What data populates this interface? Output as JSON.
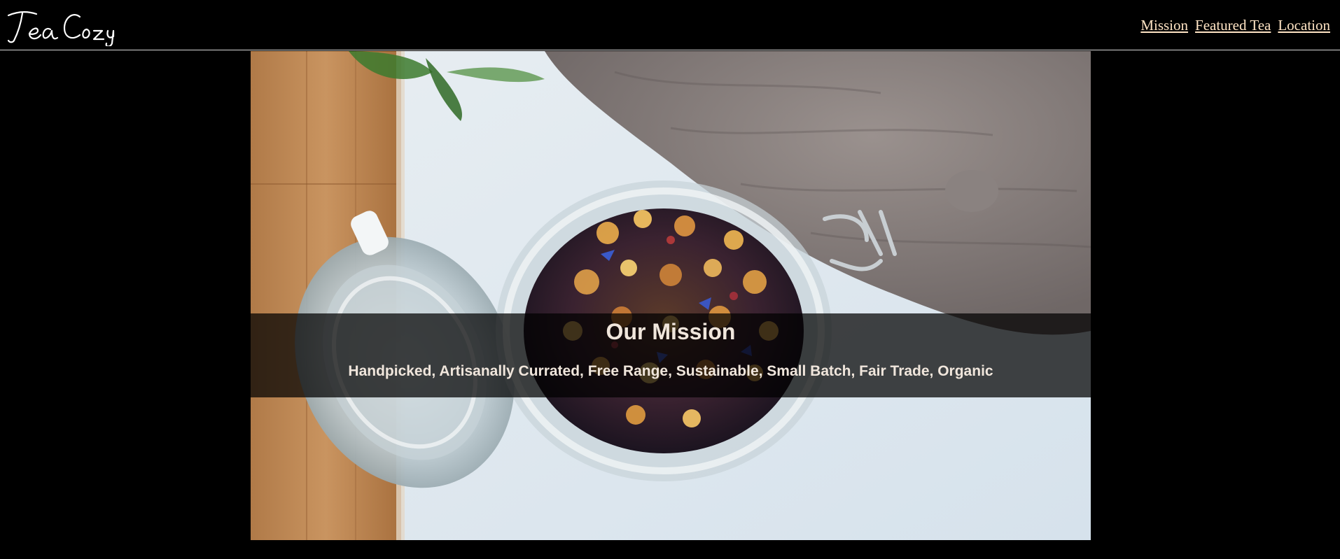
{
  "brand": {
    "name": "Tea Cozy"
  },
  "nav": {
    "items": [
      {
        "label": "Mission"
      },
      {
        "label": "Featured Tea"
      },
      {
        "label": "Location"
      }
    ]
  },
  "mission": {
    "title": "Our Mission",
    "text": "Handpicked, Artisanally Currated, Free Range, Sustainable, Small Batch, Fair Trade, Organic"
  },
  "colors": {
    "background": "#000000",
    "nav_link": "#ffe4c4",
    "mission_text": "#f0e6dc"
  }
}
